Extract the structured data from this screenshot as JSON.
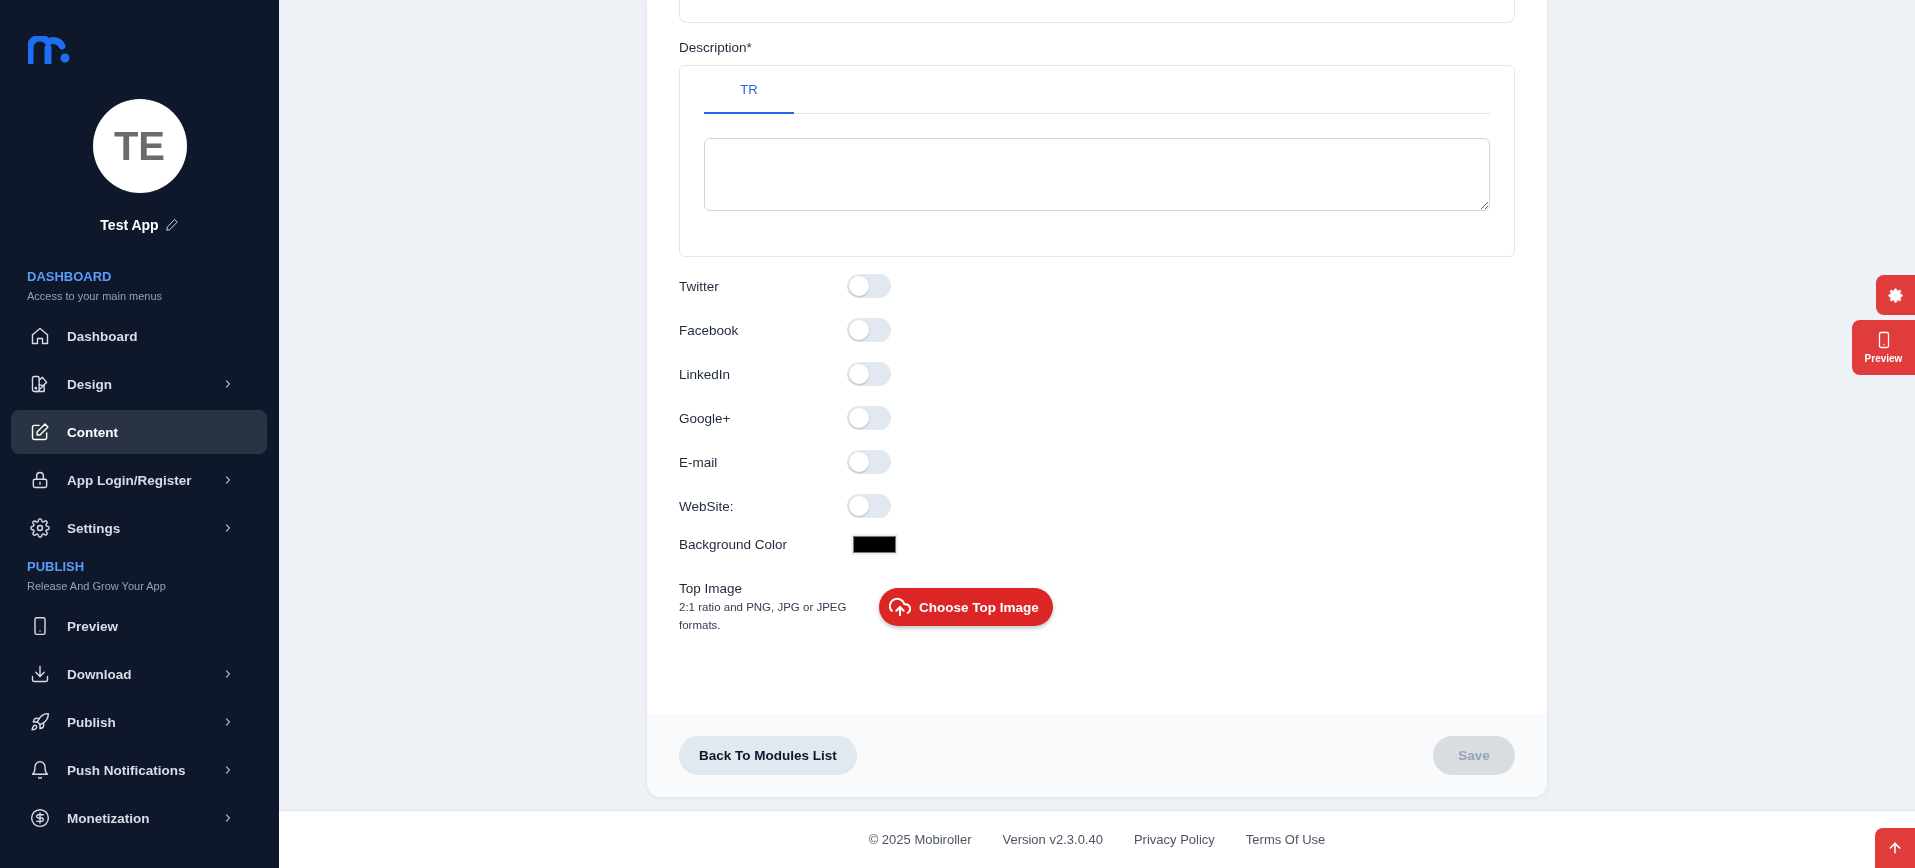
{
  "sidebar": {
    "avatar_initials": "TE",
    "app_name": "Test App",
    "sections": [
      {
        "title": "DASHBOARD",
        "subtitle": "Access to your main menus",
        "items": [
          {
            "label": "Dashboard",
            "has_submenu": false,
            "selected": false
          },
          {
            "label": "Design",
            "has_submenu": true,
            "selected": false
          },
          {
            "label": "Content",
            "has_submenu": false,
            "selected": true
          },
          {
            "label": "App Login/Register",
            "has_submenu": true,
            "selected": false
          },
          {
            "label": "Settings",
            "has_submenu": true,
            "selected": false
          }
        ]
      },
      {
        "title": "PUBLISH",
        "subtitle": "Release And Grow Your App",
        "items": [
          {
            "label": "Preview",
            "has_submenu": false,
            "selected": false
          },
          {
            "label": "Download",
            "has_submenu": true,
            "selected": false
          },
          {
            "label": "Publish",
            "has_submenu": true,
            "selected": false
          },
          {
            "label": "Push Notifications",
            "has_submenu": true,
            "selected": false
          },
          {
            "label": "Monetization",
            "has_submenu": true,
            "selected": false
          }
        ]
      }
    ]
  },
  "form": {
    "description": {
      "label": "Description*",
      "tabs": [
        {
          "label": "TR",
          "selected": true
        }
      ]
    },
    "toggles": [
      {
        "label": "Twitter",
        "on": false
      },
      {
        "label": "Facebook",
        "on": false
      },
      {
        "label": "LinkedIn",
        "on": false
      },
      {
        "label": "Google+",
        "on": false
      },
      {
        "label": "E-mail",
        "on": false
      },
      {
        "label": "WebSite:",
        "on": false
      }
    ],
    "background_color": {
      "label": "Background Color",
      "color": "#000000"
    },
    "top_image": {
      "label": "Top Image",
      "hint": "2:1 ratio and PNG, JPG or JPEG formats.",
      "button": "Choose Top Image"
    },
    "actions": {
      "back": "Back To Modules List",
      "save": {
        "label": "Save",
        "disabled": true
      }
    }
  },
  "footer": [
    "© 2025 Mobiroller",
    "Version v2.3.0.40",
    "Privacy Policy",
    "Terms Of Use"
  ],
  "floating": {
    "preview_label": "Preview"
  }
}
